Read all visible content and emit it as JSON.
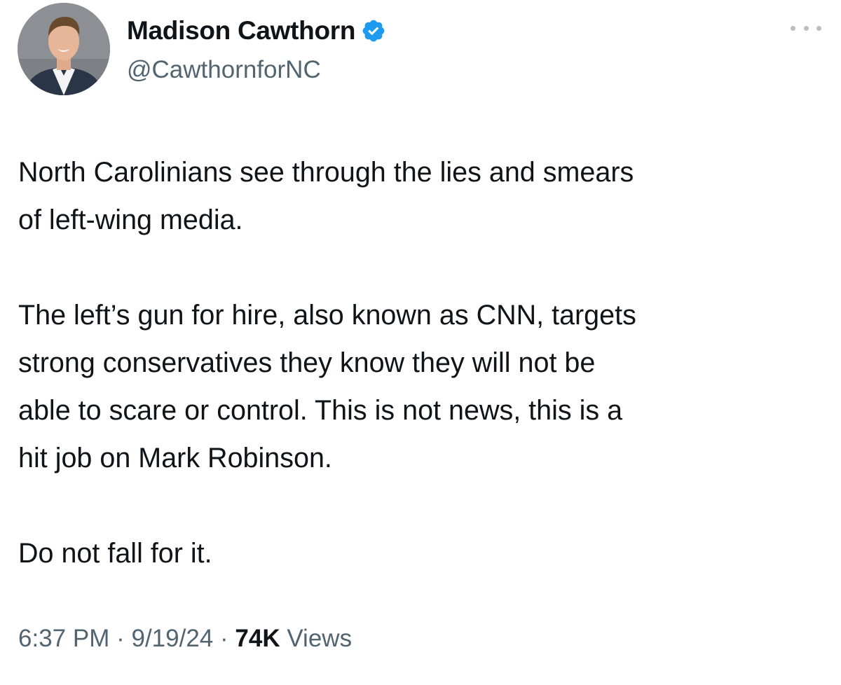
{
  "author": {
    "display_name": "Madison Cawthorn",
    "handle": "@CawthornforNC",
    "verified": true,
    "verified_icon": "verified-badge-icon",
    "avatar_icon": "profile-photo"
  },
  "more_menu_icon": "more-horizontal-icon",
  "tweet": {
    "paragraphs": [
      "North Carolinians see through the lies and smears\nof left-wing media.",
      "The left’s gun for hire, also known as CNN, targets\nstrong conservatives they know they will not be\nable to scare or control. This is not news, this is a\nhit job on Mark Robinson.",
      "Do not fall for it."
    ]
  },
  "meta": {
    "time": "6:37 PM",
    "separator": "·",
    "date": "9/19/24",
    "views_count": "74K",
    "views_label": "Views"
  },
  "colors": {
    "text_primary": "#0f1419",
    "text_secondary": "#536471",
    "verified_blue": "#1d9bf0",
    "more_dots": "#b8c0c7"
  }
}
